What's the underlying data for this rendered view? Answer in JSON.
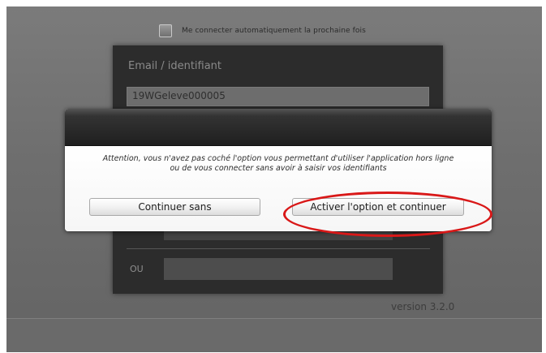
{
  "login": {
    "remember_label": "Me connecter automatiquement la prochaine fois",
    "email_label": "Email / identifiant",
    "email_value": "19WGeleve000005",
    "or_label": "OU",
    "version": "version 3.2.0"
  },
  "dialog": {
    "message_line1": "Attention, vous n'avez pas coché l'option vous permettant d'utiliser l'application hors ligne",
    "message_line2": "ou de vous connecter sans avoir à saisir vos identifiants",
    "continue_without_label": "Continuer sans",
    "activate_label": "Activer l'option et continuer"
  },
  "annotation": {
    "highlight_color": "#d91818"
  }
}
